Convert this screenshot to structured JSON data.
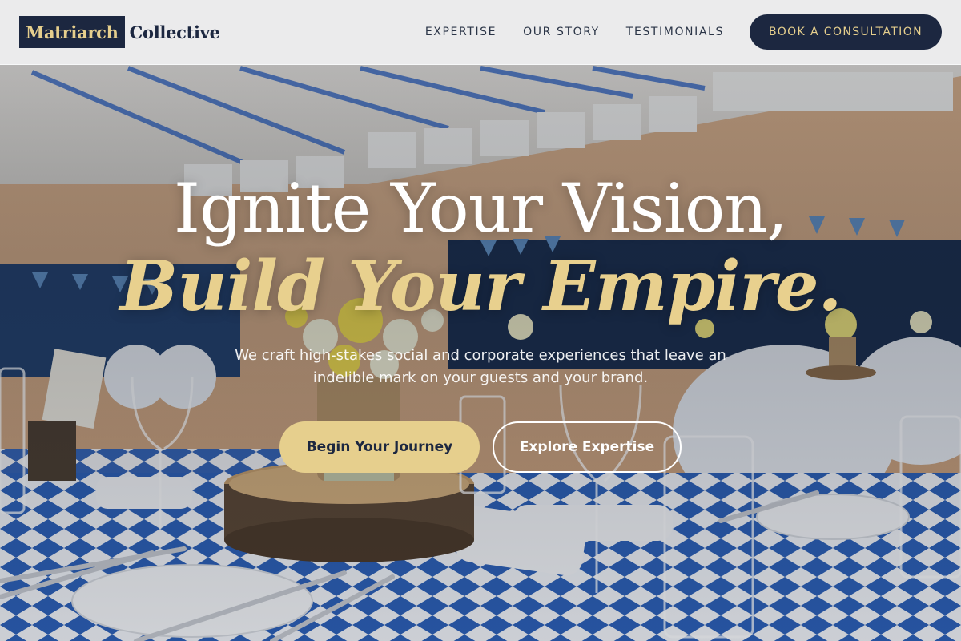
{
  "header": {
    "logo_mark": "Matriarch",
    "logo_text": "Collective",
    "nav": [
      {
        "label": "EXPERTISE"
      },
      {
        "label": "OUR STORY"
      },
      {
        "label": "TESTIMONIALS"
      }
    ],
    "cta_label": "BOOK A CONSULTATION"
  },
  "hero": {
    "headline_line1": "Ignite Your Vision,",
    "headline_line2": "Build Your Empire.",
    "subtitle": "We craft high-stakes social and corporate experiences that leave an indelible mark on your guests and your brand.",
    "primary_button": "Begin Your Journey",
    "secondary_button": "Explore Expertise"
  },
  "colors": {
    "navy": "#1c2740",
    "gold": "#e6cf8d",
    "header_bg": "#f0f2f5"
  }
}
